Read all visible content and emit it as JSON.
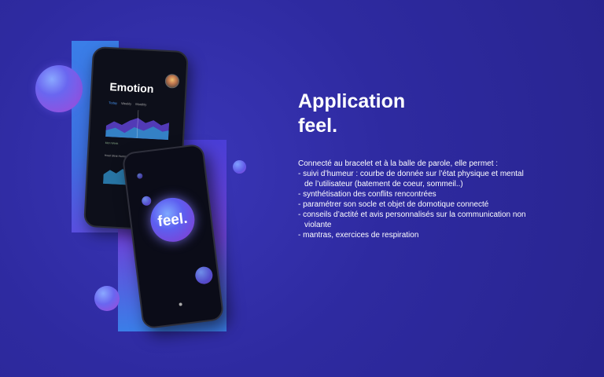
{
  "phone1": {
    "title": "Emotion",
    "tabs": [
      "Today",
      "Weekly",
      "Monthly"
    ],
    "legend": "Mon  Week",
    "sub": "Heart Beat   Humor"
  },
  "phone2": {
    "logo": "feel."
  },
  "heading": {
    "line1": "Application",
    "line2": "feel."
  },
  "description": {
    "intro": "Connecté au bracelet et à la balle de parole, elle permet :",
    "items": [
      "- suivi d’humeur : courbe de donnée sur l’état physique et mental",
      "de l’utilisateur (batement de coeur, sommeil..)",
      "- synthétisation des conflits rencontrées",
      "- paramétrer son socle et objet de domotique connecté",
      "- conseils d’actité et avis personnalisés sur la communication non",
      "violante",
      "- mantras, exercices de respiration"
    ]
  },
  "colors": {
    "background": "#2e2aa0",
    "accent_blue": "#3a7ee8",
    "accent_purple": "#6d43d8"
  }
}
